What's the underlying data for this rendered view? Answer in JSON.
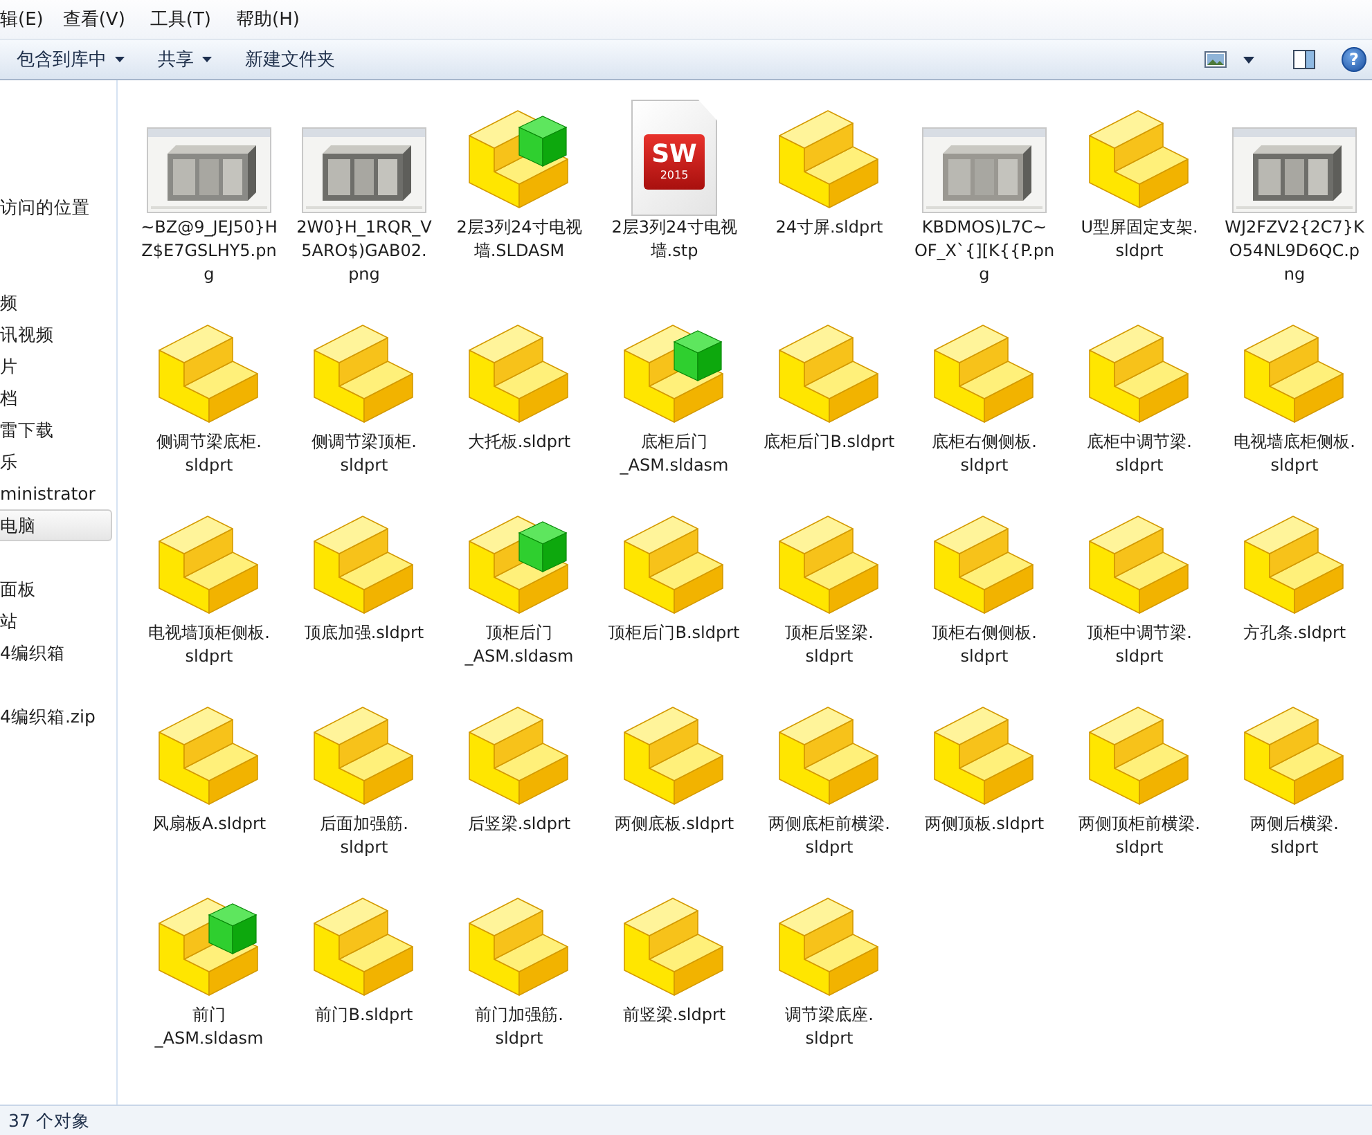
{
  "menu_bar": [
    "辑(E)",
    "查看(V)",
    "工具(T)",
    "帮助(H)"
  ],
  "toolbar": {
    "buttons": [
      {
        "label": "包含到库中",
        "dropdown": true
      },
      {
        "label": "共享",
        "dropdown": true
      },
      {
        "label": "新建文件夹",
        "dropdown": false
      }
    ],
    "help": "?"
  },
  "sidebar": {
    "groups": [
      [
        {
          "label": "访问的位置",
          "selected": false
        }
      ],
      [
        {
          "label": "频",
          "selected": false
        },
        {
          "label": "讯视频",
          "selected": false
        },
        {
          "label": "片",
          "selected": false
        },
        {
          "label": "档",
          "selected": false
        },
        {
          "label": "雷下载",
          "selected": false
        },
        {
          "label": "乐",
          "selected": false
        },
        {
          "label": "ministrator",
          "selected": false
        },
        {
          "label": "电脑",
          "selected": true
        }
      ],
      [
        {
          "label": "面板",
          "selected": false
        },
        {
          "label": "站",
          "selected": false
        },
        {
          "label": "4编织箱",
          "selected": false
        }
      ],
      [
        {
          "label": "4编织箱.zip",
          "selected": false
        }
      ]
    ]
  },
  "files": [
    {
      "lines": [
        "~BZ@9_JEJ50}H",
        "Z$E7GSLHY5.pn",
        "g"
      ]
    },
    {
      "lines": [
        "2W0}H_1RQR_V",
        "5ARO$)GAB02.",
        "png"
      ]
    },
    {
      "kind": "assembly",
      "lines": [
        "2层3列24寸电视",
        "墙.SLDASM"
      ]
    },
    {
      "kind": "document",
      "badge": "SW",
      "year": "2015",
      "lines": [
        "2层3列24寸电视",
        "墙.stp"
      ]
    },
    {
      "kind": "part",
      "lines": [
        "24寸屏.sldprt"
      ]
    },
    {
      "lines": [
        "KBDMOS)L7C~",
        "OF_X`{][K{{P.pn",
        "g"
      ]
    },
    {
      "kind": "part",
      "lines": [
        "U型屏固定支架.",
        "sldprt"
      ]
    },
    {
      "lines": [
        "WJ2FZV2{2C7}K",
        "O54NL9D6QC.p",
        "ng"
      ]
    },
    {
      "kind": "part",
      "lines": [
        "侧调节梁底柜.",
        "sldprt"
      ]
    },
    {
      "kind": "part",
      "lines": [
        "侧调节梁顶柜.",
        "sldprt"
      ]
    },
    {
      "kind": "part",
      "lines": [
        "大托板.sldprt"
      ]
    },
    {
      "kind": "assembly",
      "lines": [
        "底柜后门",
        "_ASM.sldasm"
      ]
    },
    {
      "kind": "part",
      "lines": [
        "底柜后门B.sldprt"
      ]
    },
    {
      "kind": "part",
      "lines": [
        "底柜右侧侧板.",
        "sldprt"
      ]
    },
    {
      "kind": "part",
      "lines": [
        "底柜中调节梁.",
        "sldprt"
      ]
    },
    {
      "kind": "part",
      "lines": [
        "电视墙底柜侧板.",
        "sldprt"
      ]
    },
    {
      "kind": "part",
      "lines": [
        "电视墙顶柜侧板.",
        "sldprt"
      ]
    },
    {
      "kind": "part",
      "lines": [
        "顶底加强.sldprt"
      ]
    },
    {
      "kind": "assembly",
      "lines": [
        "顶柜后门",
        "_ASM.sldasm"
      ]
    },
    {
      "kind": "part",
      "lines": [
        "顶柜后门B.sldprt"
      ]
    },
    {
      "kind": "part",
      "lines": [
        "顶柜后竖梁.",
        "sldprt"
      ]
    },
    {
      "kind": "part",
      "lines": [
        "顶柜右侧侧板.",
        "sldprt"
      ]
    },
    {
      "kind": "part",
      "lines": [
        "顶柜中调节梁.",
        "sldprt"
      ]
    },
    {
      "kind": "part",
      "lines": [
        "方孔条.sldprt"
      ]
    },
    {
      "kind": "part",
      "lines": [
        "风扇板A.sldprt"
      ]
    },
    {
      "kind": "part",
      "lines": [
        "后面加强筋.",
        "sldprt"
      ]
    },
    {
      "kind": "part",
      "lines": [
        "后竖梁.sldprt"
      ]
    },
    {
      "kind": "part",
      "lines": [
        "两侧底板.sldprt"
      ]
    },
    {
      "kind": "part",
      "lines": [
        "两侧底柜前横梁.",
        "sldprt"
      ]
    },
    {
      "kind": "part",
      "lines": [
        "两侧顶板.sldprt"
      ]
    },
    {
      "kind": "part",
      "lines": [
        "两侧顶柜前横梁.",
        "sldprt"
      ]
    },
    {
      "kind": "part",
      "lines": [
        "两侧后横梁.",
        "sldprt"
      ]
    },
    {
      "kind": "assembly",
      "lines": [
        "前门",
        "_ASM.sldasm"
      ]
    },
    {
      "kind": "part",
      "lines": [
        "前门B.sldprt"
      ]
    },
    {
      "kind": "part",
      "lines": [
        "前门加强筋.",
        "sldprt"
      ]
    },
    {
      "kind": "part",
      "lines": [
        "前竖梁.sldprt"
      ]
    },
    {
      "kind": "part",
      "lines": [
        "调节梁底座.",
        "sldprt"
      ]
    }
  ],
  "status_bar": "37 个对象"
}
